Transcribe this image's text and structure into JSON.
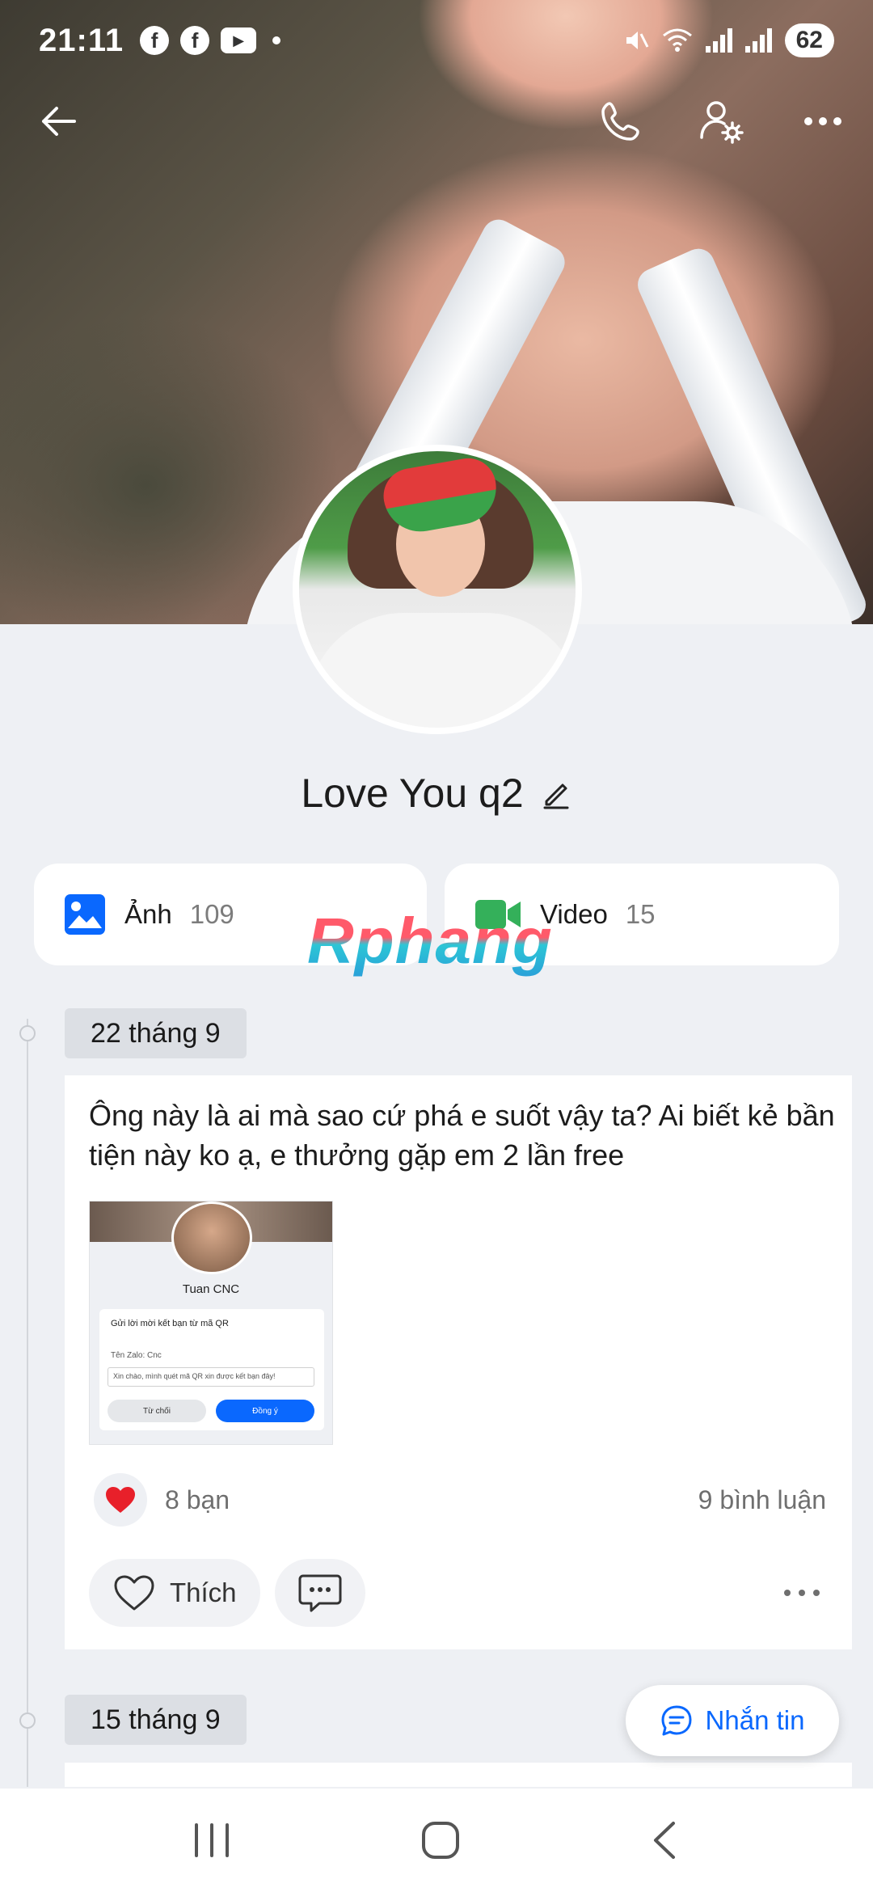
{
  "status_bar": {
    "time": "21:11",
    "battery": "62"
  },
  "profile": {
    "name": "Love You q2"
  },
  "media": {
    "photos": {
      "label": "Ảnh",
      "count": "109"
    },
    "videos": {
      "label": "Video",
      "count": "15"
    }
  },
  "watermark": "Rphang",
  "timeline": [
    {
      "date": "22 tháng 9",
      "text": "Ông này là ai mà sao cứ phá e suốt vậy ta? Ai biết kẻ bần tiện này ko ạ, e thưởng gặp em 2 lần free",
      "attachment": {
        "name": "Tuan CNC",
        "title": "Gửi lời mời kết bạn từ mã QR",
        "zalo_name": "Tên Zalo: Cnc",
        "message": "Xin chào, mình quét mã QR xin được kết bạn đây!",
        "decline": "Từ chối",
        "accept": "Đồng ý"
      },
      "reactions": "8 bạn",
      "comments": "9 bình luận",
      "like_label": "Thích"
    },
    {
      "date": "15 tháng 9"
    }
  ],
  "message_button": "Nhắn tin",
  "colors": {
    "accent": "#0a68fe",
    "heart": "#e8202a",
    "video_icon": "#34b05a"
  }
}
